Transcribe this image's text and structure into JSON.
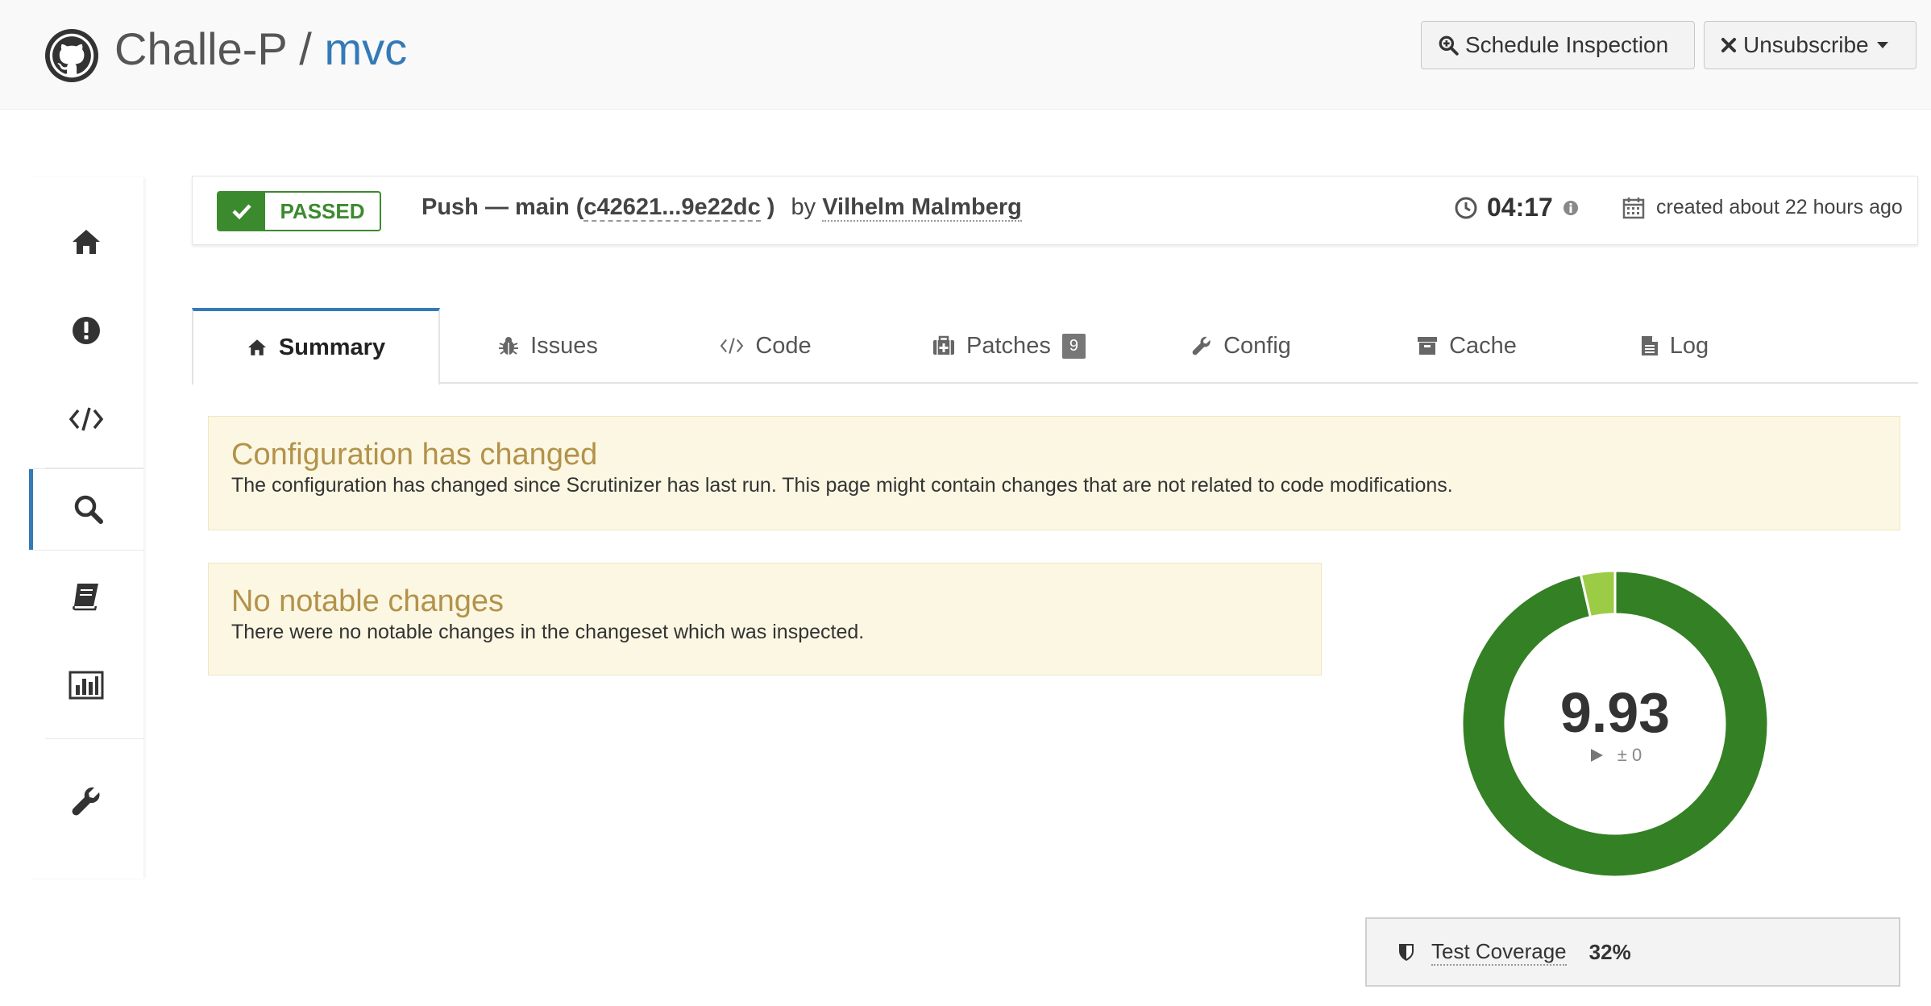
{
  "header": {
    "owner": "Challe-P",
    "separator": " / ",
    "repo": "mvc",
    "schedule_label": "Schedule Inspection",
    "unsubscribe_label": "Unsubscribe"
  },
  "sidebar": {
    "items": [
      {
        "name": "home",
        "icon": "home-icon"
      },
      {
        "name": "issues",
        "icon": "exclamation-circle-icon"
      },
      {
        "name": "code",
        "icon": "code-icon"
      },
      {
        "name": "inspections",
        "icon": "search-icon",
        "active": true
      },
      {
        "name": "docs",
        "icon": "book-icon"
      },
      {
        "name": "statistics",
        "icon": "bar-chart-icon"
      },
      {
        "name": "settings",
        "icon": "wrench-icon"
      }
    ]
  },
  "inspection": {
    "status": "PASSED",
    "push_label": "Push — main (",
    "commit_hash": "c42621...9e22dc",
    "close_paren": " )",
    "by": "by",
    "author": "Vilhelm Malmberg",
    "duration": "04:17",
    "created": "created about 22 hours ago"
  },
  "tabs": [
    {
      "label": "Summary",
      "icon": "home-icon",
      "active": true
    },
    {
      "label": "Issues",
      "icon": "bug-icon"
    },
    {
      "label": "Code",
      "icon": "code-icon"
    },
    {
      "label": "Patches",
      "icon": "medkit-icon",
      "badge": "9"
    },
    {
      "label": "Config",
      "icon": "wrench-icon"
    },
    {
      "label": "Cache",
      "icon": "archive-icon"
    },
    {
      "label": "Log",
      "icon": "file-text-icon"
    }
  ],
  "alerts": {
    "config": {
      "title": "Configuration has changed",
      "text": "The configuration has changed since Scrutinizer has last run. This page might contain changes that are not related to code modifications."
    },
    "notable": {
      "title": "No notable changes",
      "text": "There were no notable changes in the changeset which was inspected."
    }
  },
  "quality": {
    "score": "9.93",
    "delta": "± 0",
    "score_fraction": 0.964,
    "colors": {
      "good": "#348024",
      "ok": "#9ccc45"
    }
  },
  "coverage": {
    "label": "Test Coverage",
    "value": "32%"
  },
  "colors": {
    "accent": "#337ab7",
    "passed": "#3c8a2e",
    "alert_title": "#b3924a",
    "alert_bg": "#fbf7e3"
  }
}
